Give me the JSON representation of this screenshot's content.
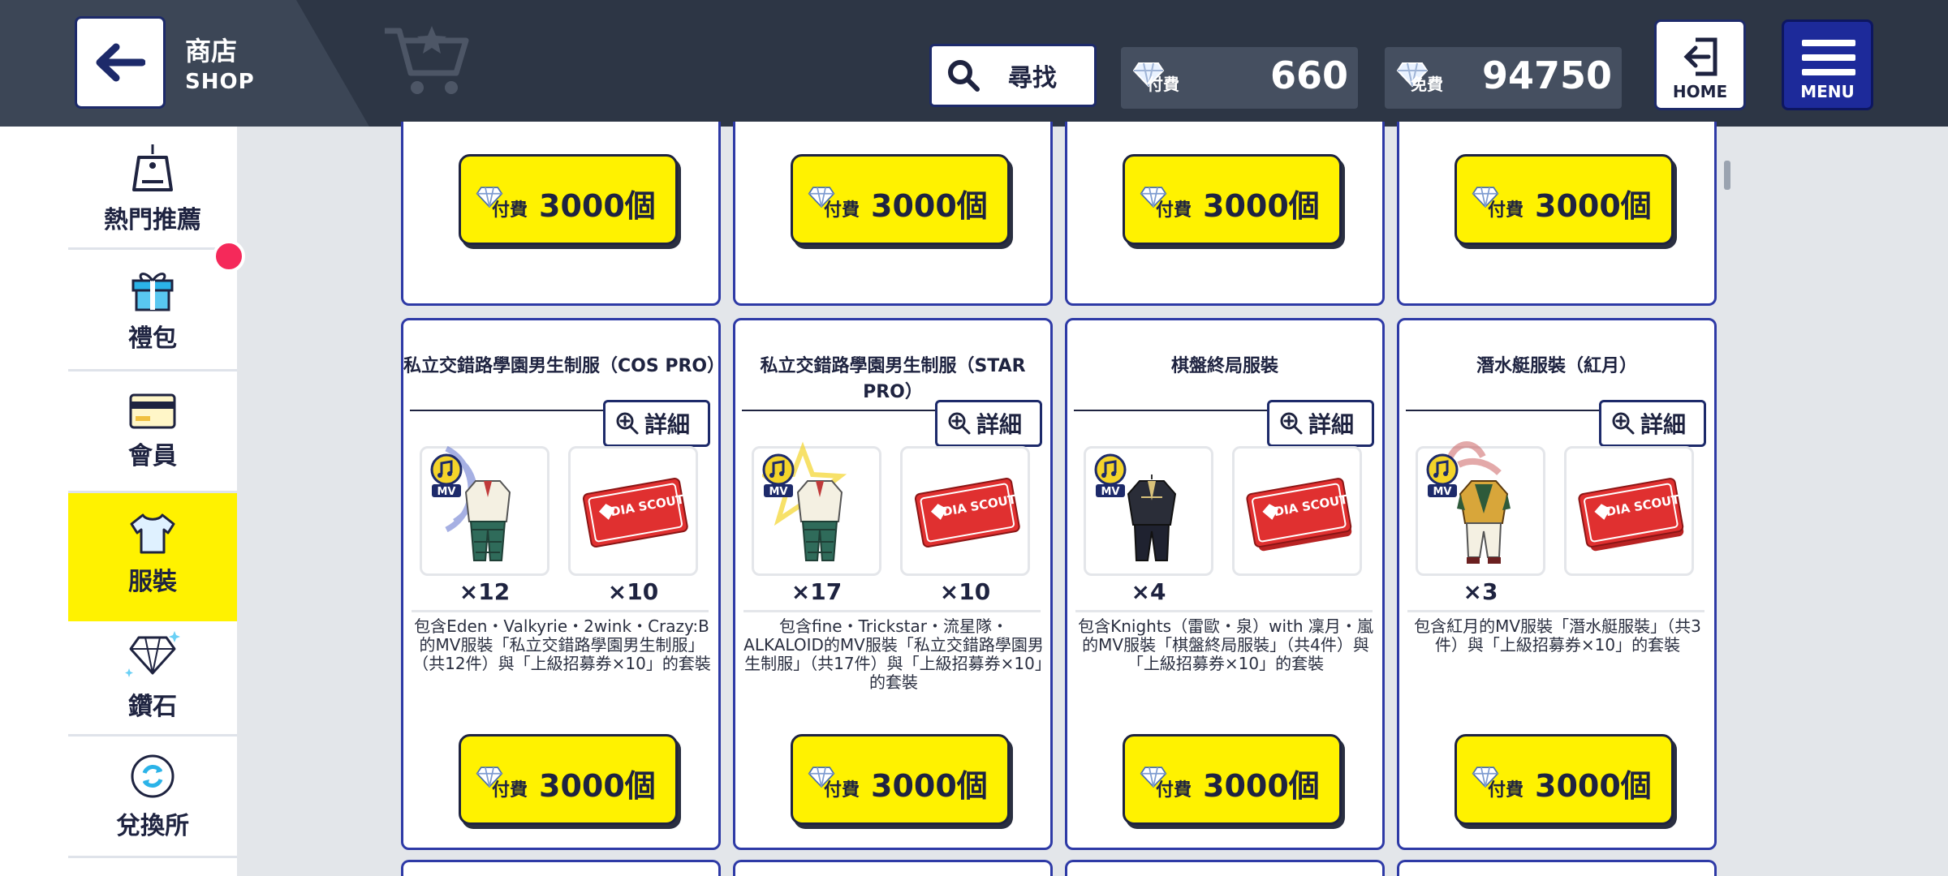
{
  "header": {
    "title_zh": "商店",
    "title_en": "SHOP",
    "search_label": "尋找",
    "paid_tag": "付費",
    "paid_value": "660",
    "free_tag": "免費",
    "free_value": "94750",
    "home_label": "HOME",
    "menu_label": "MENU"
  },
  "sidebar": {
    "items": [
      {
        "label": "熱門推薦",
        "icon": "price-tag-icon"
      },
      {
        "label": "禮包",
        "icon": "gift-icon"
      },
      {
        "label": "會員",
        "icon": "card-icon"
      },
      {
        "label": "服裝",
        "icon": "tshirt-icon",
        "active": true
      },
      {
        "label": "鑽石",
        "icon": "diamond-icon"
      },
      {
        "label": "兌換所",
        "icon": "exchange-icon"
      }
    ]
  },
  "colors": {
    "accent_yellow": "#fff200",
    "card_border": "#2e3aa6",
    "header_bg": "#2d3645",
    "notification": "#f5295a"
  },
  "top_row_prices": [
    {
      "tag": "付費",
      "value": "3000個"
    },
    {
      "tag": "付費",
      "value": "3000個"
    },
    {
      "tag": "付費",
      "value": "3000個"
    },
    {
      "tag": "付費",
      "value": "3000個"
    }
  ],
  "products": [
    {
      "title": "私立交錯路學園男生制服（COS PRO）",
      "detail_label": "詳細",
      "badge": "MV",
      "qty_outfit": "×12",
      "qty_ticket": "×10",
      "ticket_text": "DIA SCOUT",
      "description": "包含Eden・Valkyrie・2wink・Crazy:B的MV服裝「私立交錯路學園男生制服」（共12件）與「上級招募券×10」的套裝",
      "price_tag": "付費",
      "price": "3000個"
    },
    {
      "title": "私立交錯路學園男生制服（STAR PRO）",
      "detail_label": "詳細",
      "badge": "MV",
      "qty_outfit": "×17",
      "qty_ticket": "×10",
      "ticket_text": "DIA SCOUT",
      "description": "包含fine・Trickstar・流星隊・ALKALOID的MV服裝「私立交錯路學園男生制服」（共17件）與「上級招募券×10」的套裝",
      "price_tag": "付費",
      "price": "3000個"
    },
    {
      "title": "棋盤終局服裝",
      "detail_label": "詳細",
      "badge": "MV",
      "qty_outfit": "×4",
      "qty_ticket": "",
      "ticket_text": "DIA SCOUT",
      "description": "包含Knights（雷歐・泉）with 凜月・嵐的MV服裝「棋盤終局服裝」（共4件）與「上級招募券×10」的套裝",
      "price_tag": "付費",
      "price": "3000個"
    },
    {
      "title": "潛水艇服裝（紅月）",
      "detail_label": "詳細",
      "badge": "MV",
      "qty_outfit": "×3",
      "qty_ticket": "",
      "ticket_text": "DIA SCOUT",
      "description": "包含紅月的MV服裝「潛水艇服裝」（共3件）與「上級招募券×10」的套裝",
      "price_tag": "付費",
      "price": "3000個"
    }
  ]
}
